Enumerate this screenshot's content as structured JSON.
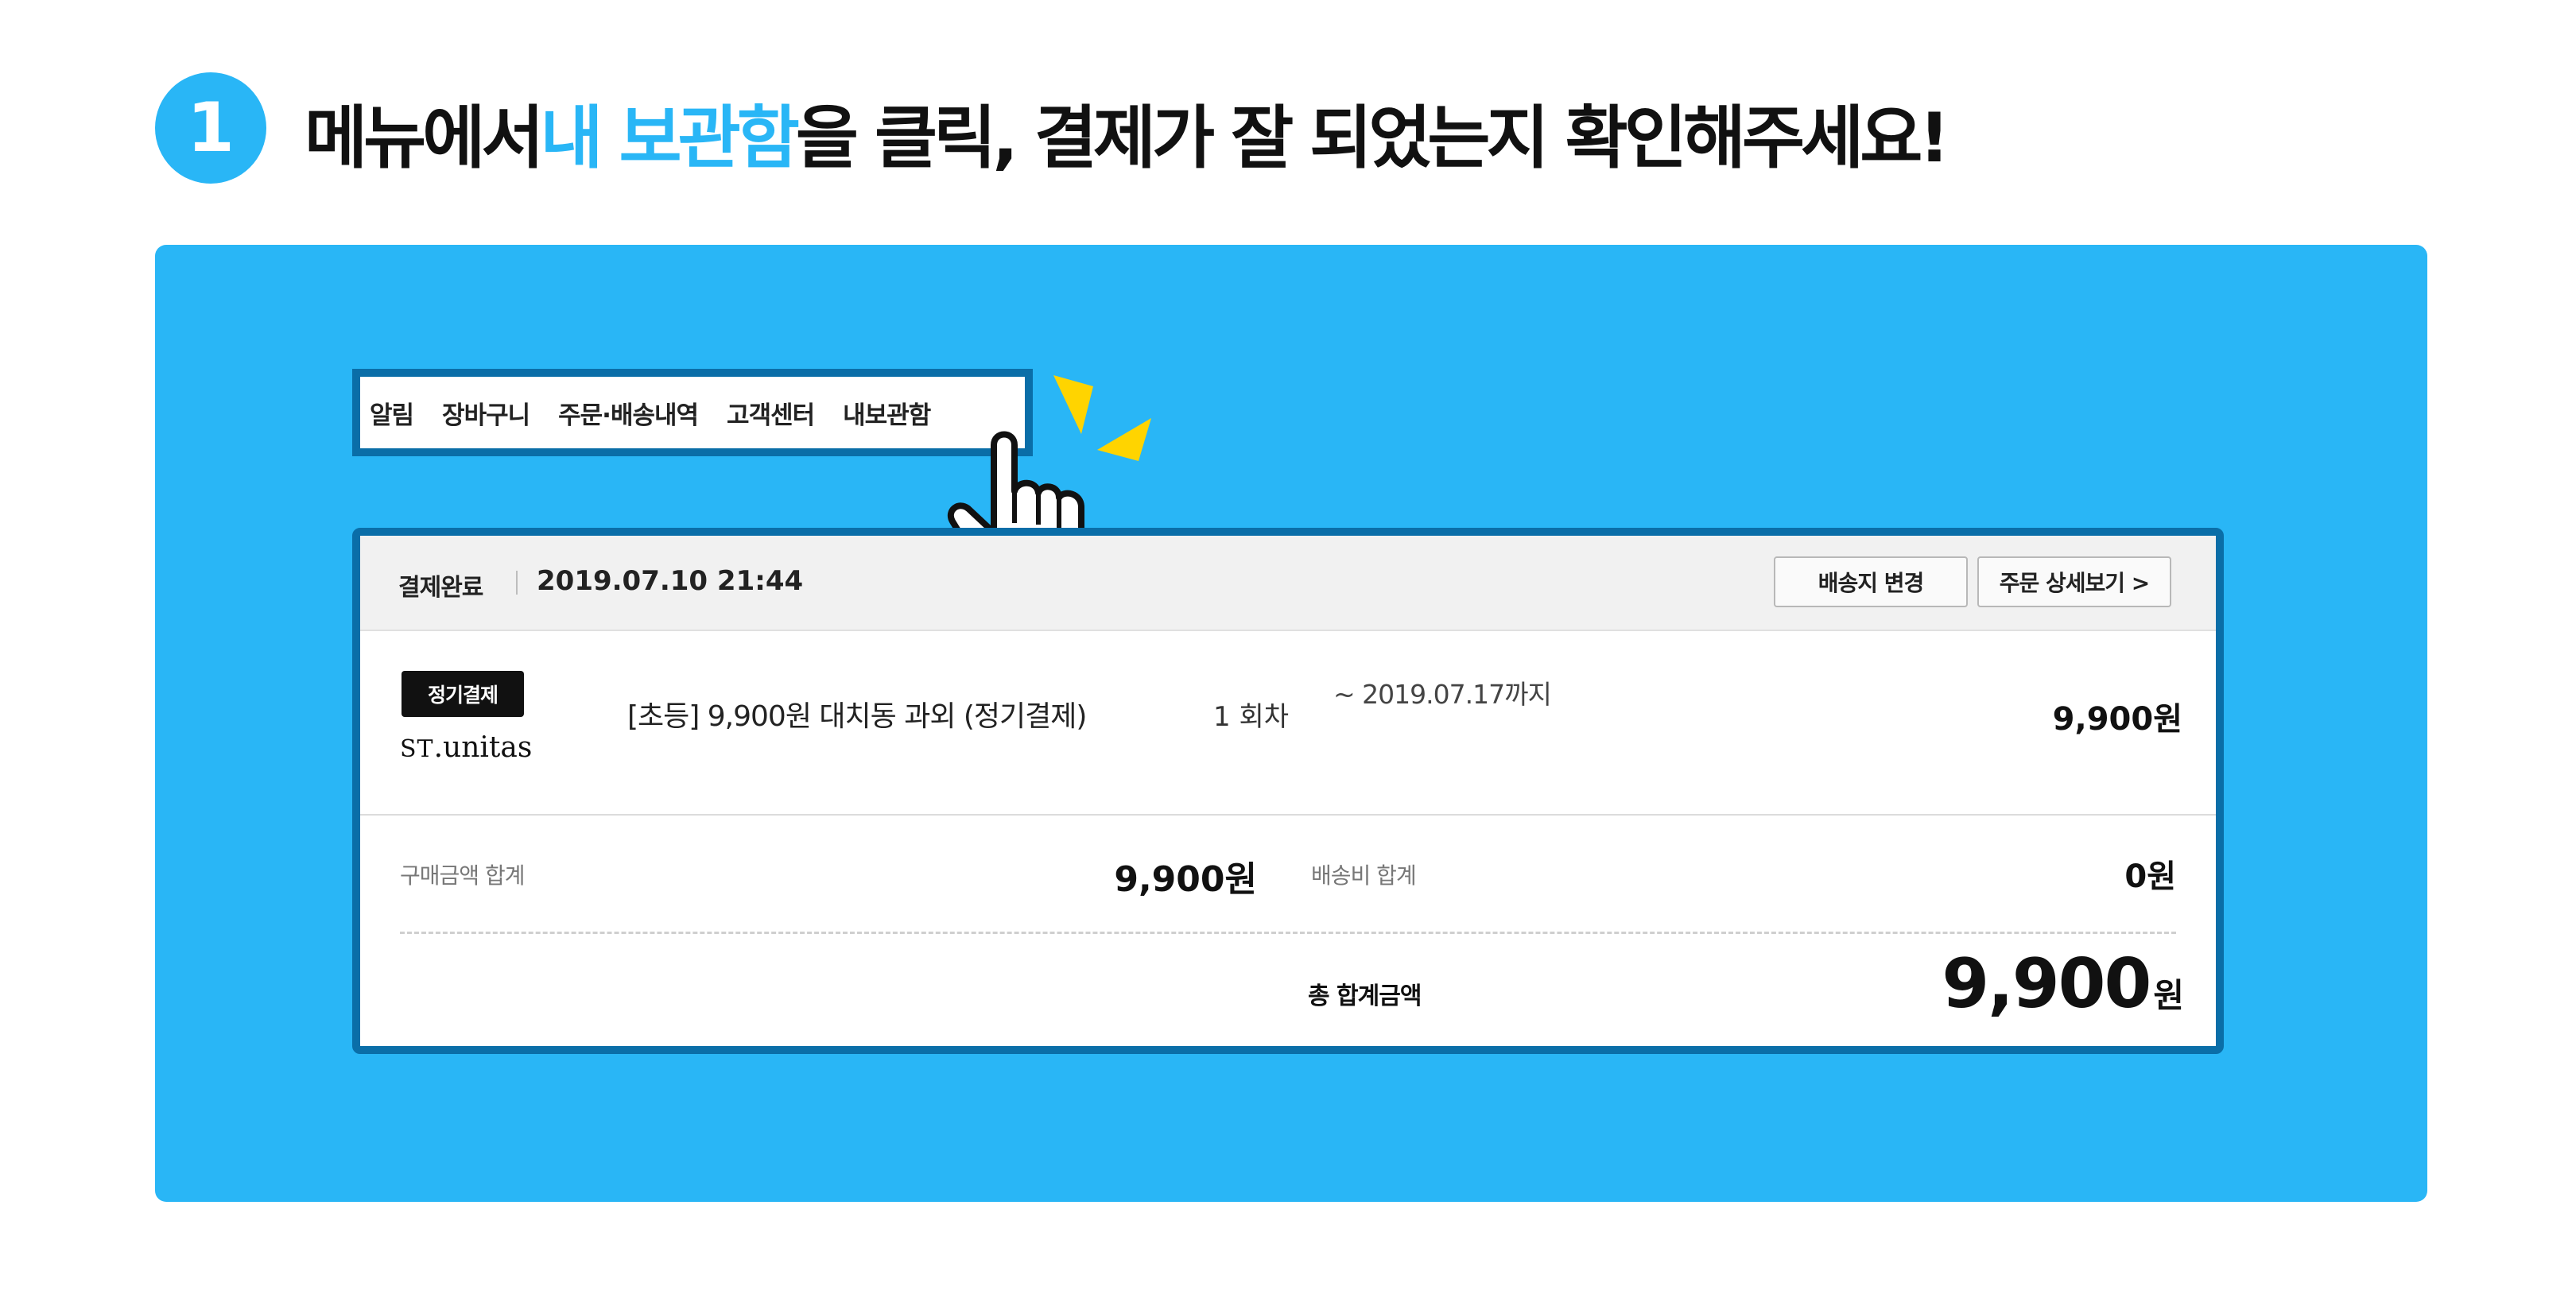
{
  "step": {
    "number": "1"
  },
  "headline": {
    "before": "메뉴에서 ",
    "highlight": "내 보관함",
    "after": "을 클릭, 결제가 잘 되었는지 확인해주세요!"
  },
  "menu": {
    "items": [
      "알림",
      "장바구니",
      "주문·배송내역",
      "고객센터",
      "내보관함"
    ]
  },
  "icons": {
    "cursor": "pointing-hand-icon",
    "click_burst": "click-burst-icon"
  },
  "order": {
    "status": "결제완료",
    "datetime": "2019.07.10 21:44",
    "buttons": {
      "change_address": "배송지 변경",
      "order_detail": "주문 상세보기 >"
    },
    "item": {
      "badge": "정기결제",
      "brand_caps": "ST",
      "brand_rest": ".unitas",
      "title": "[초등] 9,900원 대치동 과외 (정기결제)",
      "round": "1 회차",
      "period": "~ 2019.07.17까지",
      "price": "9,900원"
    },
    "summary": {
      "purchase_label": "구매금액 합계",
      "purchase_value": "9,900원",
      "shipping_label": "배송비 합계",
      "shipping_value": "0원",
      "total_label": "총 합계금액",
      "total_number": "9,900",
      "total_unit": "원"
    }
  },
  "colors": {
    "accent": "#29b6f6",
    "frame": "#0a6ea8",
    "burst": "#ffd400"
  }
}
